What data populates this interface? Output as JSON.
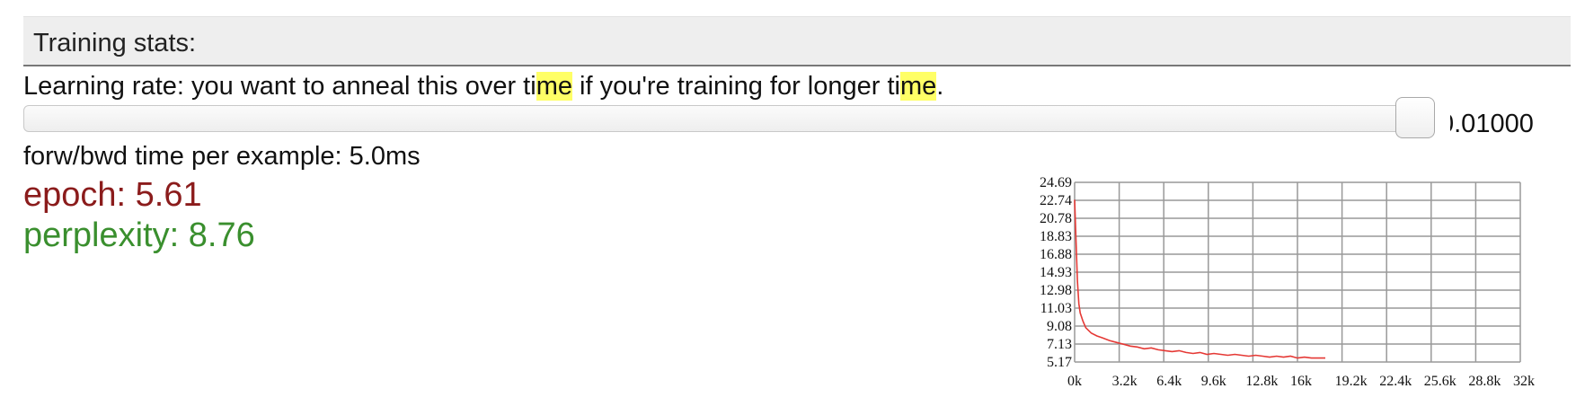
{
  "header": {
    "title": "Training stats:"
  },
  "learning_rate": {
    "description_parts": [
      "Learning rate: you want to anneal this over ti",
      "me",
      " if you're training for longer ti",
      "me",
      "."
    ],
    "value_text": "0.01000",
    "slider_fraction": 0.993
  },
  "timing": {
    "text": "forw/bwd time per example: 5.0ms"
  },
  "stats": {
    "epoch": "epoch: 5.61",
    "perplexity": "perplexity: 8.76"
  },
  "colors": {
    "epoch": "#8b1c1c",
    "perplexity": "#3a8f2e",
    "highlight": "#ffff66",
    "line": "#e53935",
    "grid": "#999999"
  },
  "chart_data": {
    "type": "line",
    "title": "",
    "xlabel": "",
    "ylabel": "",
    "x_ticks": [
      "0k",
      "3.2k",
      "6.4k",
      "9.6k",
      "12.8k",
      "16k",
      "19.2k",
      "22.4k",
      "25.6k",
      "28.8k",
      "32k"
    ],
    "y_ticks": [
      "24.69",
      "22.74",
      "20.78",
      "18.83",
      "16.88",
      "14.93",
      "12.98",
      "11.03",
      "9.08",
      "7.13",
      "5.17"
    ],
    "xlim": [
      0,
      32000
    ],
    "ylim": [
      5.17,
      24.69
    ],
    "grid": true,
    "series": [
      {
        "color": "#e53935",
        "x": [
          0,
          100,
          200,
          300,
          400,
          600,
          800,
          1200,
          1600,
          2000,
          2500,
          3000,
          3500,
          4000,
          4500,
          5000,
          5500,
          6000,
          6500,
          7000,
          7500,
          8000,
          8500,
          9000,
          9500,
          10000,
          10500,
          11000,
          11500,
          12000,
          12500,
          13000,
          13500,
          14000,
          14500,
          15000,
          15500,
          16000,
          16500,
          17000,
          17500,
          18000
        ],
        "y": [
          22.8,
          18.5,
          14.0,
          11.5,
          10.5,
          9.6,
          8.9,
          8.3,
          8.0,
          7.8,
          7.5,
          7.3,
          7.1,
          6.9,
          6.8,
          6.6,
          6.7,
          6.5,
          6.4,
          6.3,
          6.4,
          6.2,
          6.1,
          6.2,
          6.0,
          6.1,
          6.0,
          5.9,
          6.0,
          5.9,
          5.8,
          5.9,
          5.8,
          5.7,
          5.8,
          5.7,
          5.8,
          5.6,
          5.7,
          5.6,
          5.6,
          5.6
        ]
      }
    ]
  }
}
